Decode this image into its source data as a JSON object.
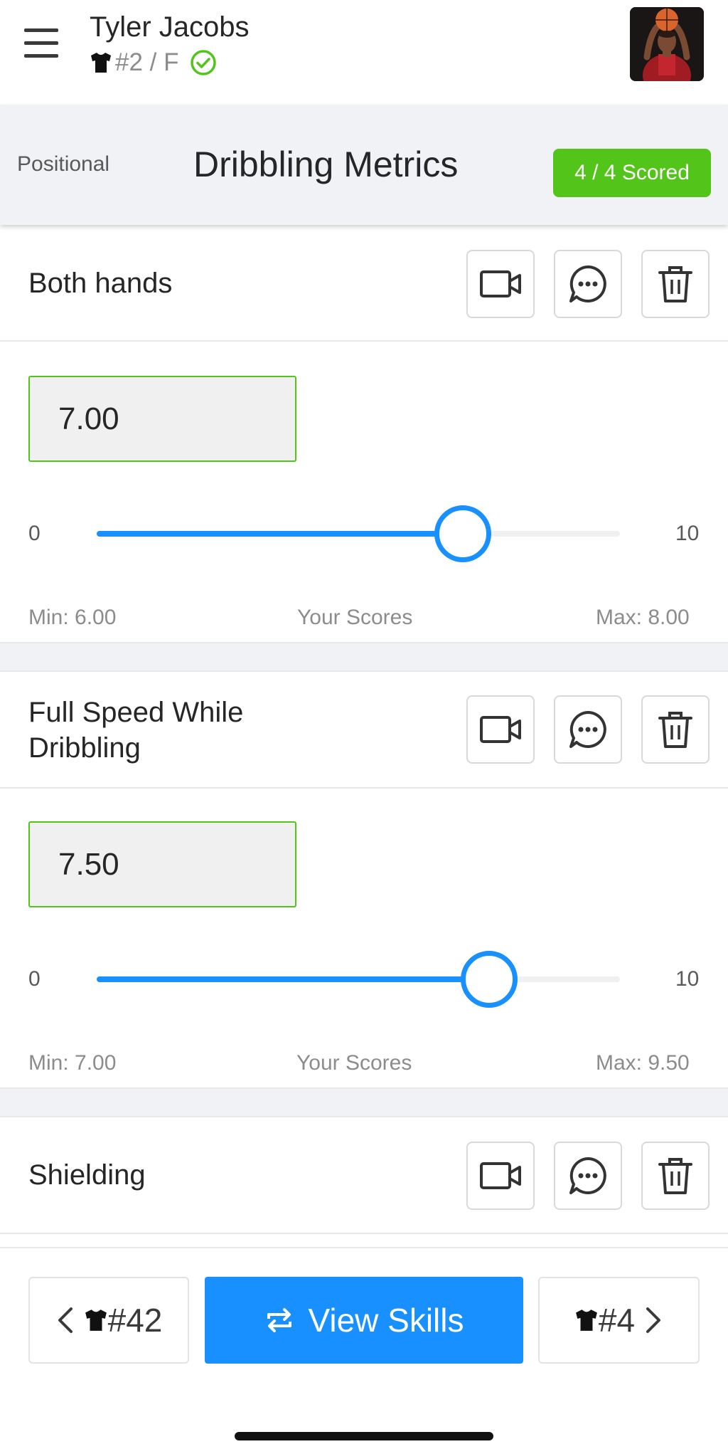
{
  "header": {
    "player_name": "Tyler Jacobs",
    "player_meta": "#2 / F",
    "menu_icon": "hamburger-icon",
    "verified_icon": "check-circle-icon",
    "accent_color": "#52c41a"
  },
  "section": {
    "tag": "Positional",
    "title": "Dribbling Metrics",
    "scored": "4 / 4 Scored"
  },
  "metrics": [
    {
      "name": "Both hands",
      "score": "7.00",
      "slider_min": "0",
      "slider_max": "10",
      "slider_value": 7.0,
      "range_min": "Min: 6.00",
      "range_label": "Your Scores",
      "range_max": "Max: 8.00"
    },
    {
      "name": "Full Speed While Dribbling",
      "score": "7.50",
      "slider_min": "0",
      "slider_max": "10",
      "slider_value": 7.5,
      "range_min": "Min: 7.00",
      "range_label": "Your Scores",
      "range_max": "Max: 9.50"
    },
    {
      "name": "Shielding"
    }
  ],
  "actions": {
    "video_icon": "video-camera-icon",
    "comment_icon": "comment-bubble-icon",
    "delete_icon": "trash-icon"
  },
  "nav": {
    "prev_label": "#42",
    "view_skills": "View Skills",
    "next_label": "#4",
    "primary_color": "#1890ff"
  }
}
